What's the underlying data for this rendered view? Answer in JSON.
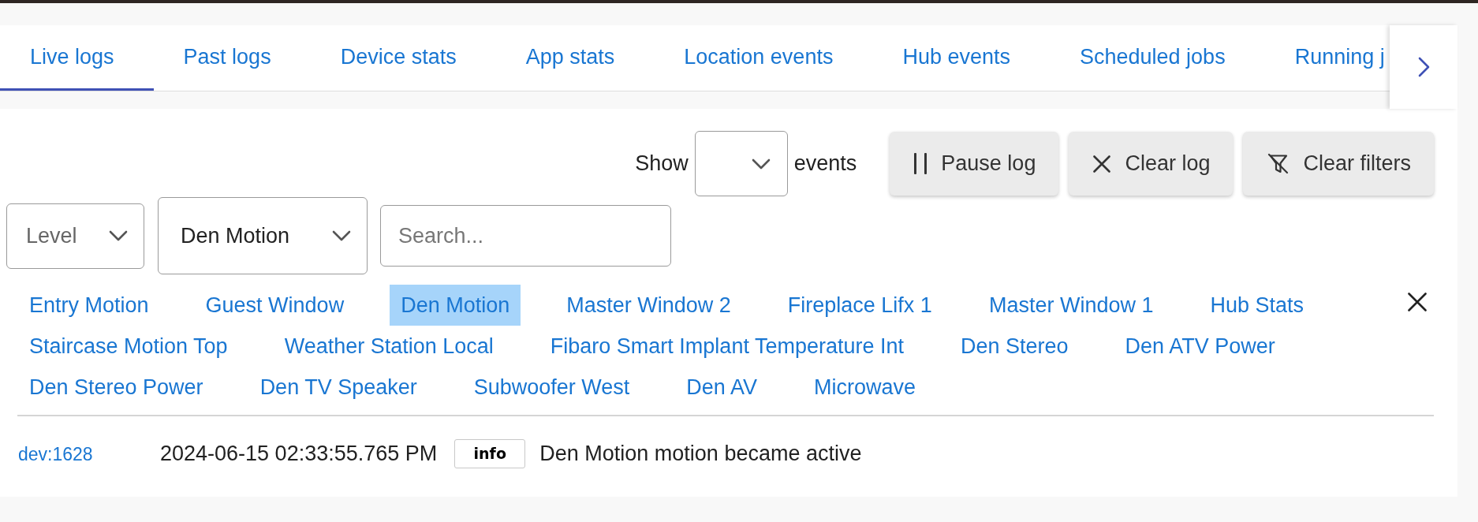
{
  "tabs": [
    {
      "label": "Live logs",
      "selected": true
    },
    {
      "label": "Past logs",
      "selected": false
    },
    {
      "label": "Device stats",
      "selected": false
    },
    {
      "label": "App stats",
      "selected": false
    },
    {
      "label": "Location events",
      "selected": false
    },
    {
      "label": "Hub events",
      "selected": false
    },
    {
      "label": "Scheduled jobs",
      "selected": false
    },
    {
      "label": "Running j",
      "selected": false
    }
  ],
  "toolbar": {
    "show_label": "Show",
    "show_suffix": "events",
    "buttons": [
      {
        "kind": "pause",
        "label": "Pause log"
      },
      {
        "kind": "clear",
        "label": "Clear log"
      },
      {
        "kind": "clear_filters",
        "label": "Clear filters"
      }
    ]
  },
  "filters": {
    "level": {
      "placeholder": "Level"
    },
    "device": {
      "value": "Den Motion"
    },
    "search": {
      "placeholder": "Search..."
    }
  },
  "device_chips": [
    {
      "label": "Entry Motion",
      "selected": false
    },
    {
      "label": "Guest Window",
      "selected": false
    },
    {
      "label": "Den Motion",
      "selected": true
    },
    {
      "label": "Master Window 2",
      "selected": false
    },
    {
      "label": "Fireplace Lifx 1",
      "selected": false
    },
    {
      "label": "Master Window 1",
      "selected": false
    },
    {
      "label": "Hub Stats",
      "selected": false
    },
    {
      "label": "Staircase Motion Top",
      "selected": false
    },
    {
      "label": "Weather Station Local",
      "selected": false
    },
    {
      "label": "Fibaro Smart Implant Temperature Int",
      "selected": false
    },
    {
      "label": "Den Stereo",
      "selected": false
    },
    {
      "label": "Den ATV Power",
      "selected": false
    },
    {
      "label": "Den Stereo Power",
      "selected": false
    },
    {
      "label": "Den TV Speaker",
      "selected": false
    },
    {
      "label": "Subwoofer West",
      "selected": false
    },
    {
      "label": "Den AV",
      "selected": false
    },
    {
      "label": "Microwave",
      "selected": false
    }
  ],
  "log_entries": [
    {
      "device": "dev:1628",
      "time": "2024-06-15 02:33:55.765 PM",
      "level": "info",
      "message": "Den Motion motion became active"
    }
  ]
}
